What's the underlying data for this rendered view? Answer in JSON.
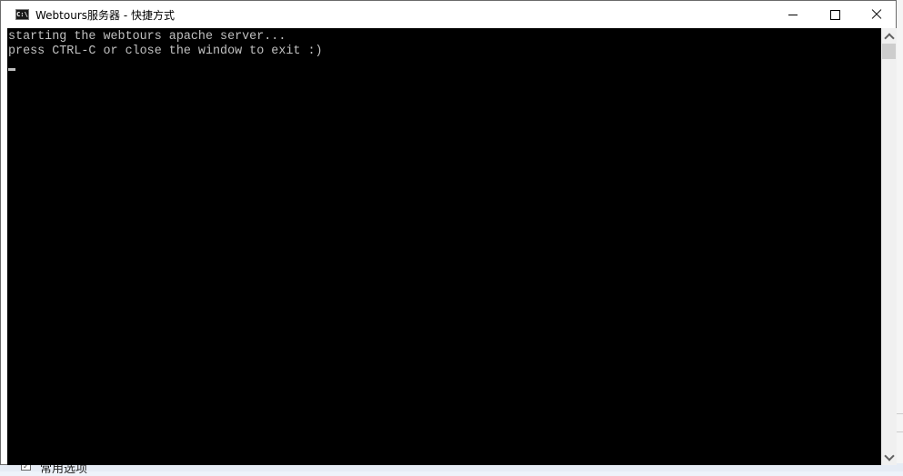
{
  "window": {
    "title": "Webtours服务器 - 快捷方式",
    "icon": "console-icon",
    "icon_text": "C:\\",
    "controls": {
      "minimize": "minimize-icon",
      "maximize": "maximize-icon",
      "close": "close-icon"
    }
  },
  "console": {
    "lines": [
      "starting the webtours apache server...",
      "press CTRL-C or close the window to exit :)"
    ]
  },
  "background": {
    "checkbox_label": "常用选项",
    "checkbox_checked": true
  }
}
